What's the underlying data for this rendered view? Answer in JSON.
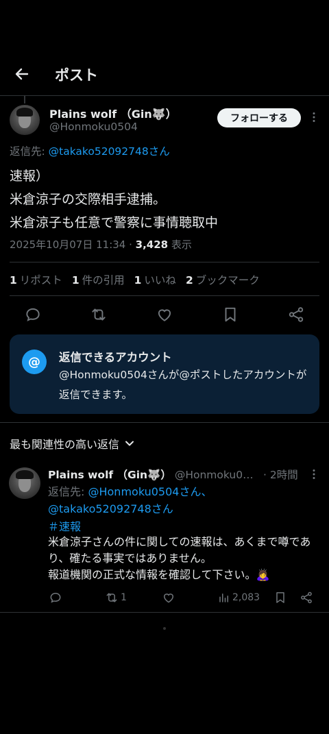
{
  "header": {
    "title": "ポスト"
  },
  "post": {
    "author_name": "Plains wolf （Gin🐺）",
    "author_handle": "@Honmoku0504",
    "follow_label": "フォローする",
    "replying_prefix": "返信先: ",
    "replying_to": "@takako52092748さん",
    "text": "速報）\n米倉涼子の交際相手逮捕。\n米倉涼子も任意で警察に事情聴取中",
    "timestamp": "2025年10月07日 11:34 · ",
    "views_count": "3,428",
    "views_label": " 表示"
  },
  "stats": {
    "reposts_count": "1",
    "reposts_label": "リポスト",
    "quotes_count": "1",
    "quotes_label": "件の引用",
    "likes_count": "1",
    "likes_label": "いいね",
    "bookmarks_count": "2",
    "bookmarks_label": "ブックマーク"
  },
  "reply_card": {
    "icon": "@",
    "title": "返信できるアカウント",
    "body": "@Honmoku0504さんが@ポストしたアカウントが返信できます。"
  },
  "sort_label": "最も関連性の高い返信",
  "reply": {
    "author_name": "Plains wolf （Gin🐺）",
    "author_handle": "@Honmoku0…",
    "time": "· 2時間",
    "replying_prefix": "返信先: ",
    "replying_to_1": "@Honmoku0504さん、",
    "replying_to_2": "@takako52092748さん",
    "hashtag": "＃速報",
    "text": "米倉涼子さんの件に関しての速報は、あくまで噂であり、確たる事実ではありません。\n報道機関の正式な情報を確認して下さい。🙇‍♀️",
    "repost_count": "1",
    "views_count": "2,083"
  },
  "colors": {
    "accent": "#1d9bf0",
    "muted": "#71767b",
    "card_bg": "#0b2035"
  },
  "icons": [
    "back-arrow-icon",
    "more-icon",
    "reply-icon",
    "repost-icon",
    "like-icon",
    "bookmark-icon",
    "share-icon",
    "at-icon",
    "chevron-down-icon",
    "views-icon"
  ]
}
